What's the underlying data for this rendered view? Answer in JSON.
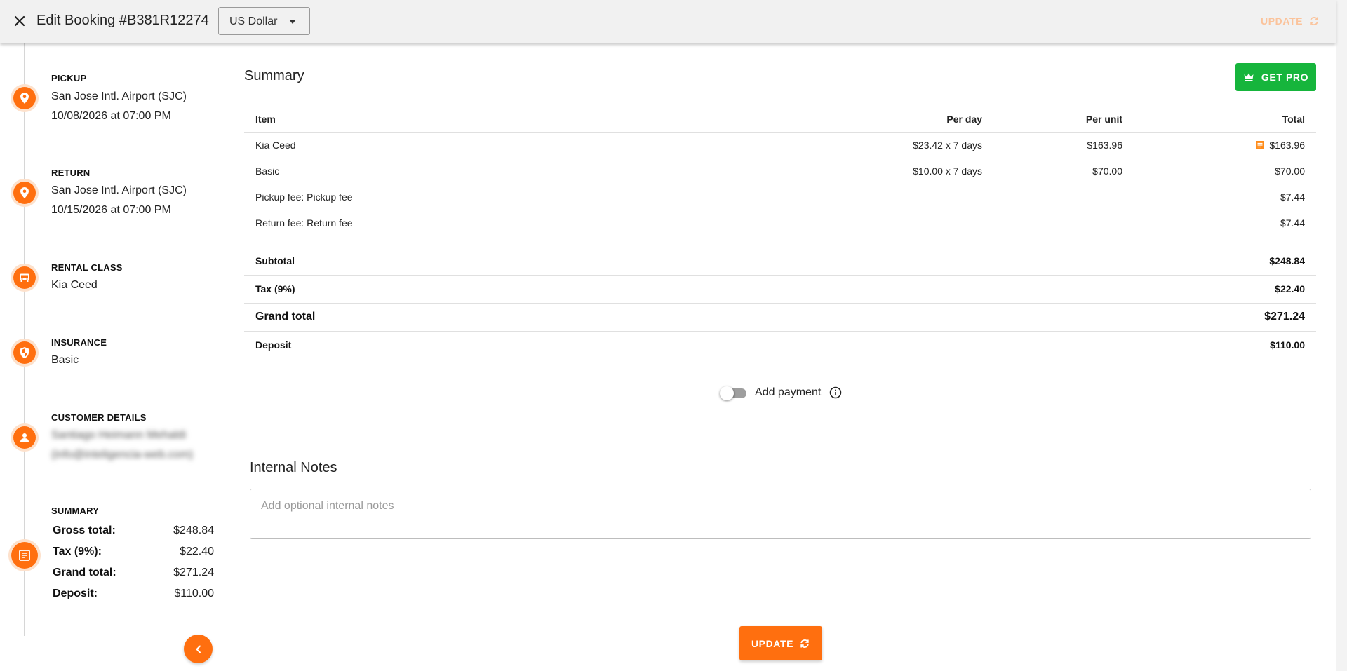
{
  "header": {
    "title": "Edit Booking #B381R12274",
    "currency": "US Dollar",
    "update_label": "UPDATE"
  },
  "sidebar": {
    "pickup": {
      "label": "PICKUP",
      "location": "San Jose Intl. Airport (SJC)",
      "datetime": "10/08/2026 at 07:00 PM"
    },
    "return": {
      "label": "RETURN",
      "location": "San Jose Intl. Airport (SJC)",
      "datetime": "10/15/2026 at 07:00 PM"
    },
    "rental_class": {
      "label": "RENTAL CLASS",
      "value": "Kia Ceed"
    },
    "insurance": {
      "label": "INSURANCE",
      "value": "Basic"
    },
    "customer": {
      "label": "CUSTOMER DETAILS",
      "name": "Santiago Heimann Mehaldi",
      "email": "(info@inteligencia-web.com)"
    },
    "summary": {
      "label": "SUMMARY",
      "rows": [
        {
          "key": "Gross total:",
          "value": "$248.84"
        },
        {
          "key": "Tax (9%):",
          "value": "$22.40"
        },
        {
          "key": "Grand total:",
          "value": "$271.24"
        },
        {
          "key": "Deposit:",
          "value": "$110.00"
        }
      ]
    }
  },
  "main": {
    "title": "Summary",
    "get_pro": "GET PRO",
    "columns": [
      "Item",
      "Per day",
      "Per unit",
      "Total"
    ],
    "rows": [
      {
        "item": "Kia Ceed",
        "per_day": "$23.42 x 7 days",
        "per_unit": "$163.96",
        "total": "$163.96"
      },
      {
        "item": "Basic",
        "per_day": "$10.00 x 7 days",
        "per_unit": "$70.00",
        "total": "$70.00"
      },
      {
        "item": "Pickup fee: Pickup fee",
        "per_day": "",
        "per_unit": "",
        "total": "$7.44"
      },
      {
        "item": "Return fee: Return fee",
        "per_day": "",
        "per_unit": "",
        "total": "$7.44"
      }
    ],
    "totals": [
      {
        "label": "Subtotal",
        "value": "$248.84"
      },
      {
        "label": "Tax (9%)",
        "value": "$22.40"
      },
      {
        "label": "Grand total",
        "value": "$271.24"
      },
      {
        "label": "Deposit",
        "value": "$110.00"
      }
    ],
    "add_payment": "Add payment",
    "add_payment_enabled": false,
    "notes_title": "Internal Notes",
    "notes_placeholder": "Add optional internal notes",
    "notes_value": "",
    "update_label": "UPDATE"
  },
  "colors": {
    "accent": "#ff6f0f",
    "accent_light": "#fde1cc",
    "pro_green": "#16b53c"
  },
  "icons": [
    "close-icon",
    "chevron-down-icon",
    "refresh-icon",
    "map-pin-icon",
    "car-icon",
    "shield-icon",
    "person-icon",
    "document-icon",
    "chevron-left-icon",
    "crown-icon",
    "info-icon"
  ]
}
